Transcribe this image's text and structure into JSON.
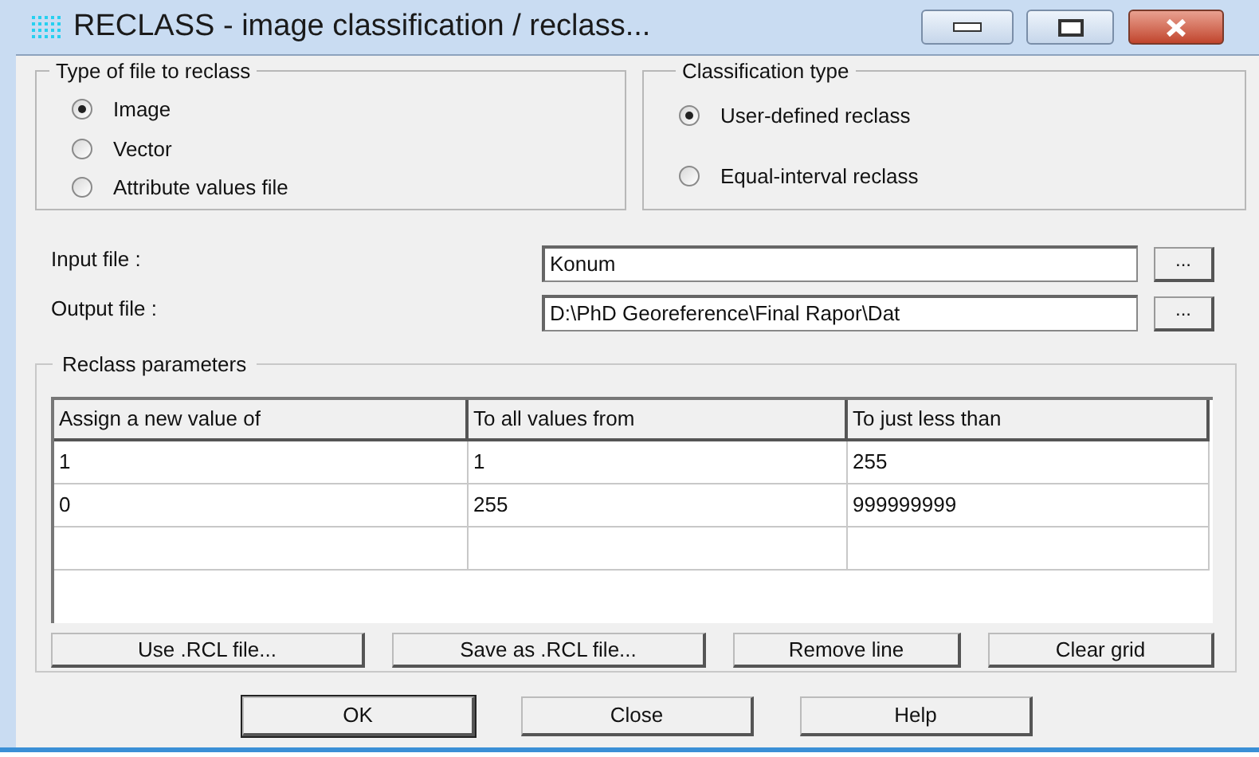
{
  "window": {
    "title": "RECLASS - image classification / reclass..."
  },
  "file_type": {
    "title": "Type of file to reclass",
    "options": [
      {
        "label": "Image",
        "selected": true
      },
      {
        "label": "Vector",
        "selected": false
      },
      {
        "label": "Attribute values file",
        "selected": false
      }
    ]
  },
  "classification_type": {
    "title": "Classification type",
    "options": [
      {
        "label": "User-defined reclass",
        "selected": true
      },
      {
        "label": "Equal-interval reclass",
        "selected": false
      }
    ]
  },
  "input_file": {
    "label": "Input file :",
    "value": "Konum",
    "browse": "..."
  },
  "output_file": {
    "label": "Output file :",
    "value": "D:\\PhD Georeference\\Final Rapor\\Dat",
    "browse": "..."
  },
  "reclass_parameters": {
    "title": "Reclass parameters",
    "columns": [
      "Assign a new value of",
      "To all values from",
      "To just less than"
    ],
    "rows": [
      [
        "1",
        "1",
        "255"
      ],
      [
        "0",
        "255",
        "999999999"
      ]
    ],
    "buttons": [
      "Use .RCL file...",
      "Save as .RCL file...",
      "Remove line",
      "Clear grid"
    ]
  },
  "buttons": [
    "OK",
    "Close",
    "Help"
  ]
}
